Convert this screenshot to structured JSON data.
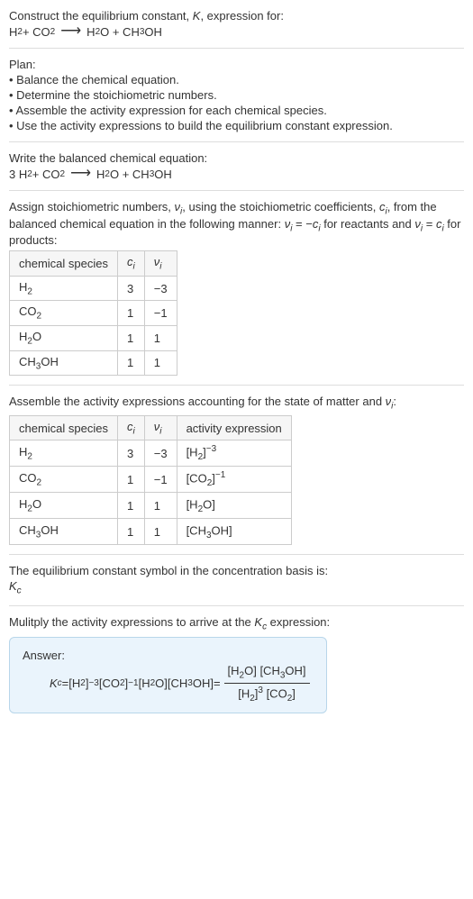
{
  "intro": {
    "title_prefix": "Construct the equilibrium constant, ",
    "title_K": "K",
    "title_suffix": ", expression for:",
    "eq_lhs_1": "H",
    "eq_lhs_1_sub": "2",
    "eq_lhs_plus": " + CO",
    "eq_lhs_2_sub": "2",
    "eq_arrow": "⟶",
    "eq_rhs_1": " H",
    "eq_rhs_1_sub": "2",
    "eq_rhs_1_tail": "O + CH",
    "eq_rhs_2_sub": "3",
    "eq_rhs_2_tail": "OH"
  },
  "plan": {
    "heading": "Plan:",
    "b1": "• Balance the chemical equation.",
    "b2": "• Determine the stoichiometric numbers.",
    "b3": "• Assemble the activity expression for each chemical species.",
    "b4": "• Use the activity expressions to build the equilibrium constant expression."
  },
  "balanced": {
    "heading": "Write the balanced chemical equation:",
    "lhs_coeff": "3 H",
    "lhs_sub1": "2",
    "lhs_plus": " + CO",
    "lhs_sub2": "2",
    "arrow": "⟶",
    "rhs_1": " H",
    "rhs_sub1": "2",
    "rhs_1_tail": "O + CH",
    "rhs_sub2": "3",
    "rhs_2_tail": "OH"
  },
  "stoich": {
    "text_a": "Assign stoichiometric numbers, ",
    "nu": "ν",
    "i": "i",
    "text_b": ", using the stoichiometric coefficients, ",
    "c": "c",
    "text_c": ", from the balanced chemical equation in the following manner: ",
    "eq1_lhs": "ν",
    "eq1_eq": " = −",
    "eq1_rhs": "c",
    "text_d": " for reactants and ",
    "eq2": " = ",
    "text_e": " for products:"
  },
  "table1": {
    "h1": "chemical species",
    "h2_c": "c",
    "h2_i": "i",
    "h3_nu": "ν",
    "h3_i": "i",
    "rows": [
      {
        "sp_a": "H",
        "sp_sub": "2",
        "sp_b": "",
        "c": "3",
        "nu": "−3"
      },
      {
        "sp_a": "CO",
        "sp_sub": "2",
        "sp_b": "",
        "c": "1",
        "nu": "−1"
      },
      {
        "sp_a": "H",
        "sp_sub": "2",
        "sp_b": "O",
        "c": "1",
        "nu": "1"
      },
      {
        "sp_a": "CH",
        "sp_sub": "3",
        "sp_b": "OH",
        "c": "1",
        "nu": "1"
      }
    ]
  },
  "activity_heading_a": "Assemble the activity expressions accounting for the state of matter and ",
  "activity_heading_b": ":",
  "table2": {
    "h1": "chemical species",
    "h4": "activity expression",
    "rows": [
      {
        "sp_a": "H",
        "sp_sub": "2",
        "sp_b": "",
        "c": "3",
        "nu": "−3",
        "act_a": "[H",
        "act_sub": "2",
        "act_b": "]",
        "act_sup": "−3"
      },
      {
        "sp_a": "CO",
        "sp_sub": "2",
        "sp_b": "",
        "c": "1",
        "nu": "−1",
        "act_a": "[CO",
        "act_sub": "2",
        "act_b": "]",
        "act_sup": "−1"
      },
      {
        "sp_a": "H",
        "sp_sub": "2",
        "sp_b": "O",
        "c": "1",
        "nu": "1",
        "act_a": "[H",
        "act_sub": "2",
        "act_b": "O]",
        "act_sup": ""
      },
      {
        "sp_a": "CH",
        "sp_sub": "3",
        "sp_b": "OH",
        "c": "1",
        "nu": "1",
        "act_a": "[CH",
        "act_sub": "3",
        "act_b": "OH]",
        "act_sup": ""
      }
    ]
  },
  "symbol_line": "The equilibrium constant symbol in the concentration basis is:",
  "Kc_K": "K",
  "Kc_c": "c",
  "multiply_a": "Mulitply the activity expressions to arrive at the ",
  "multiply_b": " expression:",
  "answer": {
    "label": "Answer:",
    "lhs_K": "K",
    "lhs_c": "c",
    "eq": " = ",
    "t1_a": "[H",
    "t1_sub": "2",
    "t1_b": "]",
    "t1_sup": "−3",
    "t2_a": " [CO",
    "t2_sub": "2",
    "t2_b": "]",
    "t2_sup": "−1",
    "t3_a": " [H",
    "t3_sub": "2",
    "t3_b": "O]",
    "t4_a": " [CH",
    "t4_sub": "3",
    "t4_b": "OH]",
    "eq2": " = ",
    "num_a": "[H",
    "num_sub1": "2",
    "num_b": "O] [CH",
    "num_sub2": "3",
    "num_c": "OH]",
    "den_a": "[H",
    "den_sub1": "2",
    "den_b": "]",
    "den_sup": "3",
    "den_c": " [CO",
    "den_sub2": "2",
    "den_d": "]"
  },
  "chart_data": {
    "type": "table",
    "title": "Stoichiometric coefficients and activity expressions",
    "columns": [
      "chemical species",
      "c_i",
      "ν_i",
      "activity expression"
    ],
    "rows": [
      [
        "H2",
        3,
        -3,
        "[H2]^-3"
      ],
      [
        "CO2",
        1,
        -1,
        "[CO2]^-1"
      ],
      [
        "H2O",
        1,
        1,
        "[H2O]"
      ],
      [
        "CH3OH",
        1,
        1,
        "[CH3OH]"
      ]
    ]
  }
}
